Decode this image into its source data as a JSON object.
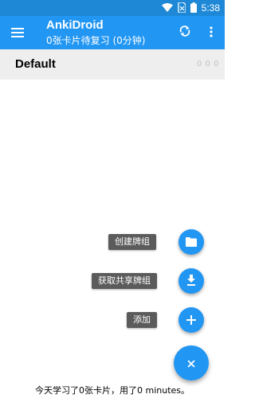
{
  "status_bar": {
    "time": "5:38",
    "icons": [
      "wifi-icon",
      "sim-no-signal-icon",
      "battery-icon"
    ],
    "background": "#1e88d6"
  },
  "toolbar": {
    "title": "AnkiDroid",
    "subtitle": "0张卡片待复习 (0分钟)",
    "icons": [
      "menu-icon",
      "sync-icon",
      "more-vert-icon"
    ],
    "background": "#2196f3"
  },
  "deck_list": [
    {
      "name": "Default",
      "counts": [
        "0",
        "0",
        "0"
      ]
    }
  ],
  "fab_menu": {
    "items": [
      {
        "label": "创建牌组",
        "icon": "folder-icon"
      },
      {
        "label": "获取共享牌组",
        "icon": "download-icon"
      },
      {
        "label": "添加",
        "icon": "plus-icon"
      }
    ],
    "main_icon": "close-icon",
    "accent": "#2196f3"
  },
  "footer": {
    "text": "今天学习了0张卡片，用了0 minutes。"
  }
}
